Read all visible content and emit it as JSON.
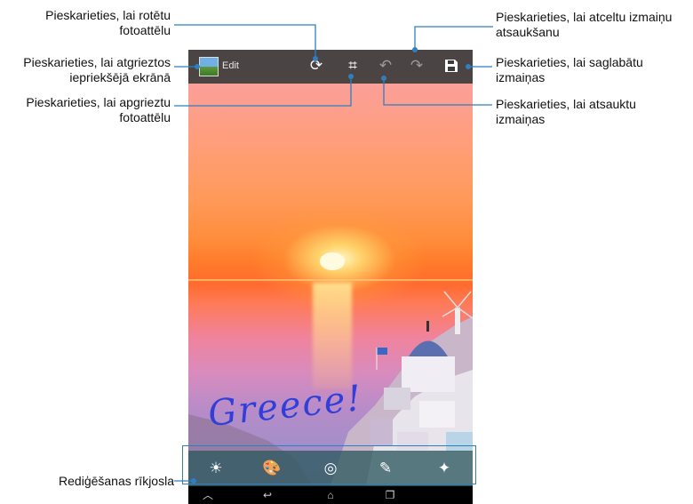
{
  "callouts": {
    "rotate": "Pieskarieties, lai rotētu\nfotoattēlu",
    "back": "Pieskarieties, lai atgrieztos\niepriekšējā ekrānā",
    "crop": "Pieskarieties, lai apgrieztu\nfotoattēlu",
    "redo": "Pieskarieties, lai atceltu izmaiņu\natsaukšanu",
    "save": "Pieskarieties, lai saglabātu\nizmaiņas",
    "undo": "Pieskarieties, lai atsauktu\nizmaiņas",
    "toolbar": "Rediģēšanas rīkjosla"
  },
  "screen": {
    "edit_label": "Edit",
    "handwriting": "Greece!"
  },
  "icons": {
    "top": [
      "rotate-icon",
      "crop-icon",
      "undo-icon",
      "redo-icon",
      "save-icon"
    ],
    "bottom": [
      "brightness-icon",
      "palette-icon",
      "effects-icon",
      "draw-icon",
      "sparkle-icon"
    ],
    "nav": [
      "home-chevron-icon",
      "back-icon",
      "home-icon",
      "recents-icon"
    ]
  },
  "colors": {
    "topbar": "#3c3c3c",
    "bottombar": "#2d5a5f",
    "leader": "#2e7fc0",
    "handwriting": "#2f3fd8"
  }
}
